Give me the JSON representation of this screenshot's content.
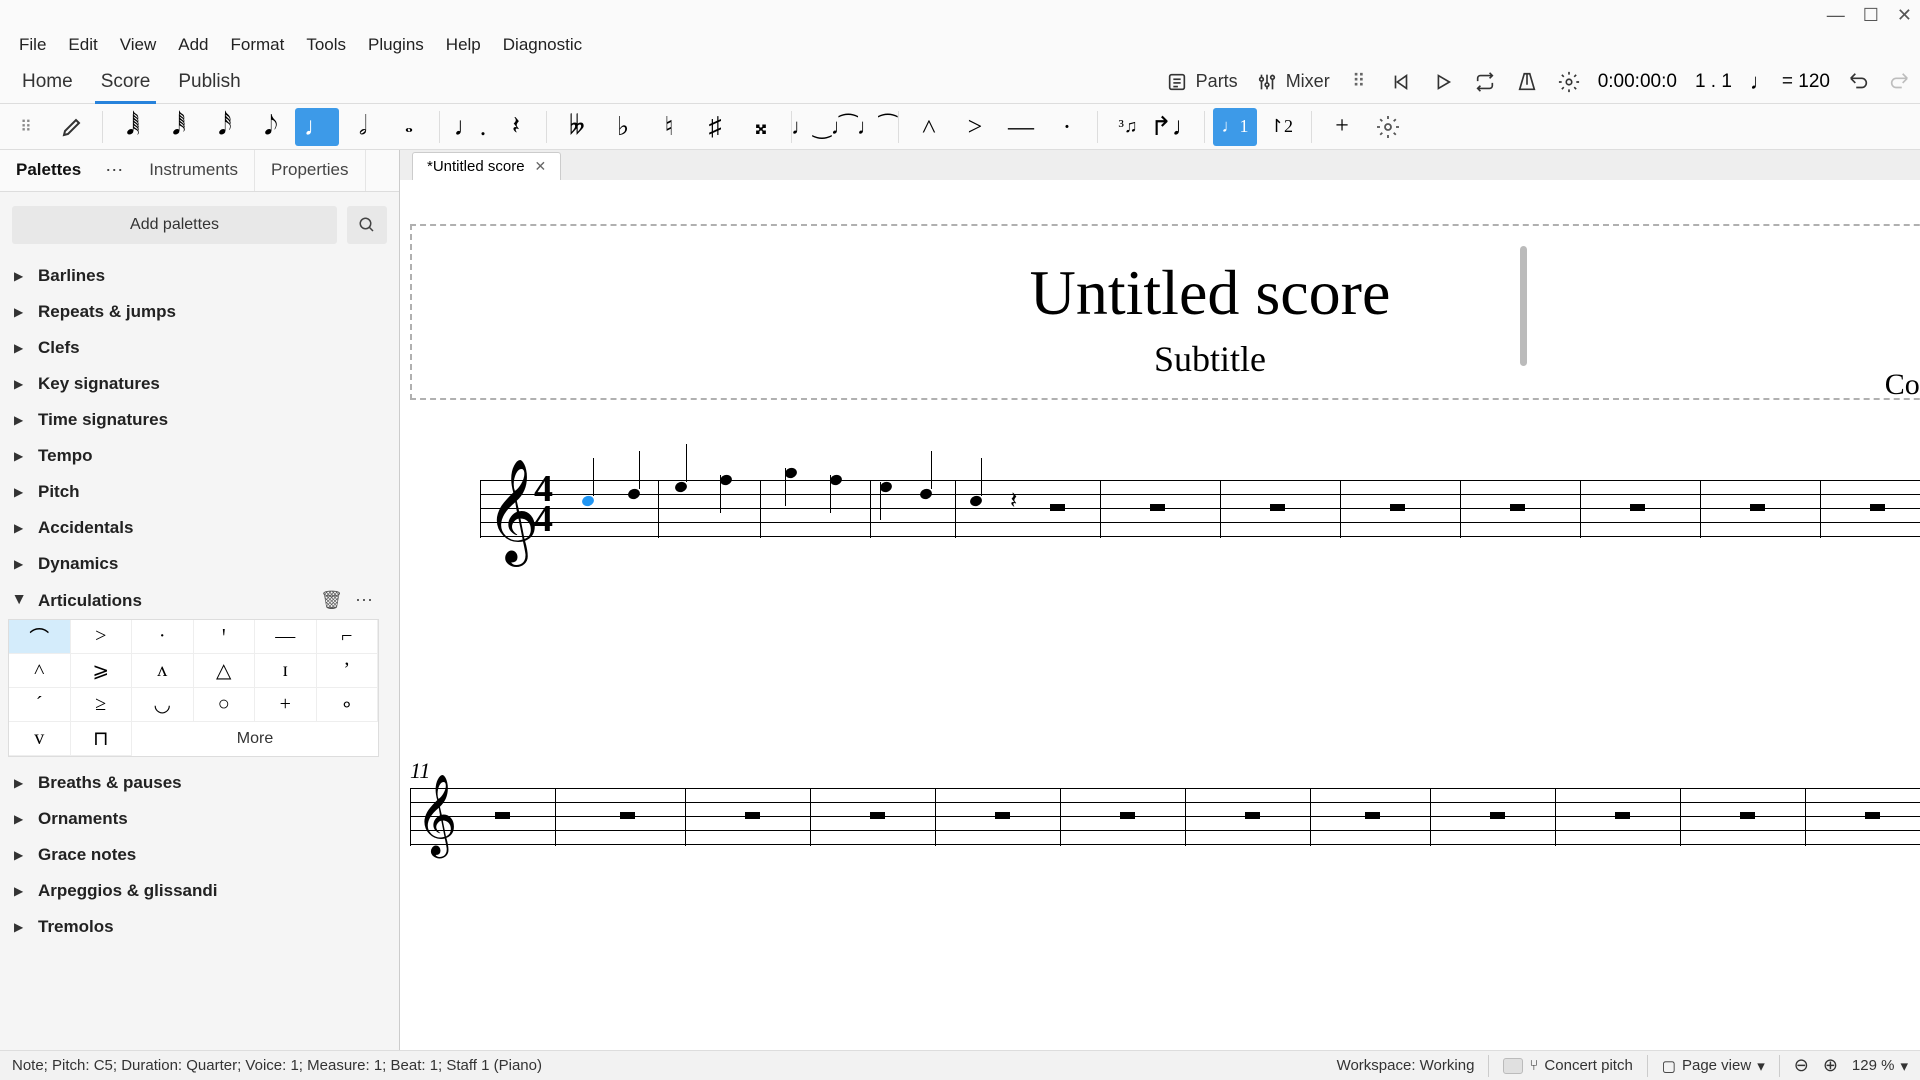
{
  "window_controls": {
    "minimize": "—",
    "maximize": "☐",
    "close": "✕"
  },
  "menu": [
    "File",
    "Edit",
    "View",
    "Add",
    "Format",
    "Tools",
    "Plugins",
    "Help",
    "Diagnostic"
  ],
  "tabs": {
    "home": "Home",
    "score": "Score",
    "publish": "Publish"
  },
  "right_controls": {
    "parts": "Parts",
    "mixer": "Mixer",
    "time_counter": "0:00:00:0",
    "position": "1 . 1",
    "tempo_label": "= 120"
  },
  "sidebar": {
    "tabs": {
      "palettes": "Palettes",
      "instruments": "Instruments",
      "properties": "Properties"
    },
    "add_palettes": "Add palettes",
    "categories": {
      "barlines": "Barlines",
      "repeats": "Repeats & jumps",
      "clefs": "Clefs",
      "keysig": "Key signatures",
      "timesig": "Time signatures",
      "tempo": "Tempo",
      "pitch": "Pitch",
      "accidentals": "Accidentals",
      "dynamics": "Dynamics",
      "articulations": "Articulations",
      "breaths": "Breaths & pauses",
      "ornaments": "Ornaments",
      "grace": "Grace notes",
      "arpeggios": "Arpeggios & glissandi",
      "tremolos": "Tremolos"
    },
    "artic_cells": [
      "⌒",
      ">",
      "·",
      "ꞌ",
      "—",
      "⌐",
      "˄",
      "⩾",
      "ʌ",
      "△",
      "ɪ",
      "ʼ",
      "´",
      "≥",
      "◡",
      "○",
      "+",
      "∘",
      "v",
      "⊓"
    ],
    "more": "More"
  },
  "doc_tab": "*Untitled score",
  "score": {
    "title": "Untitled score",
    "subtitle": "Subtitle",
    "composer": "Composer / arra",
    "measure_num": "11"
  },
  "status": {
    "left": "Note; Pitch: C5; Duration: Quarter; Voice: 1; Measure: 1; Beat: 1; Staff 1 (Piano)",
    "workspace": "Workspace: Working",
    "concert_pitch": "Concert pitch",
    "page_view": "Page view",
    "zoom": "129 %"
  }
}
